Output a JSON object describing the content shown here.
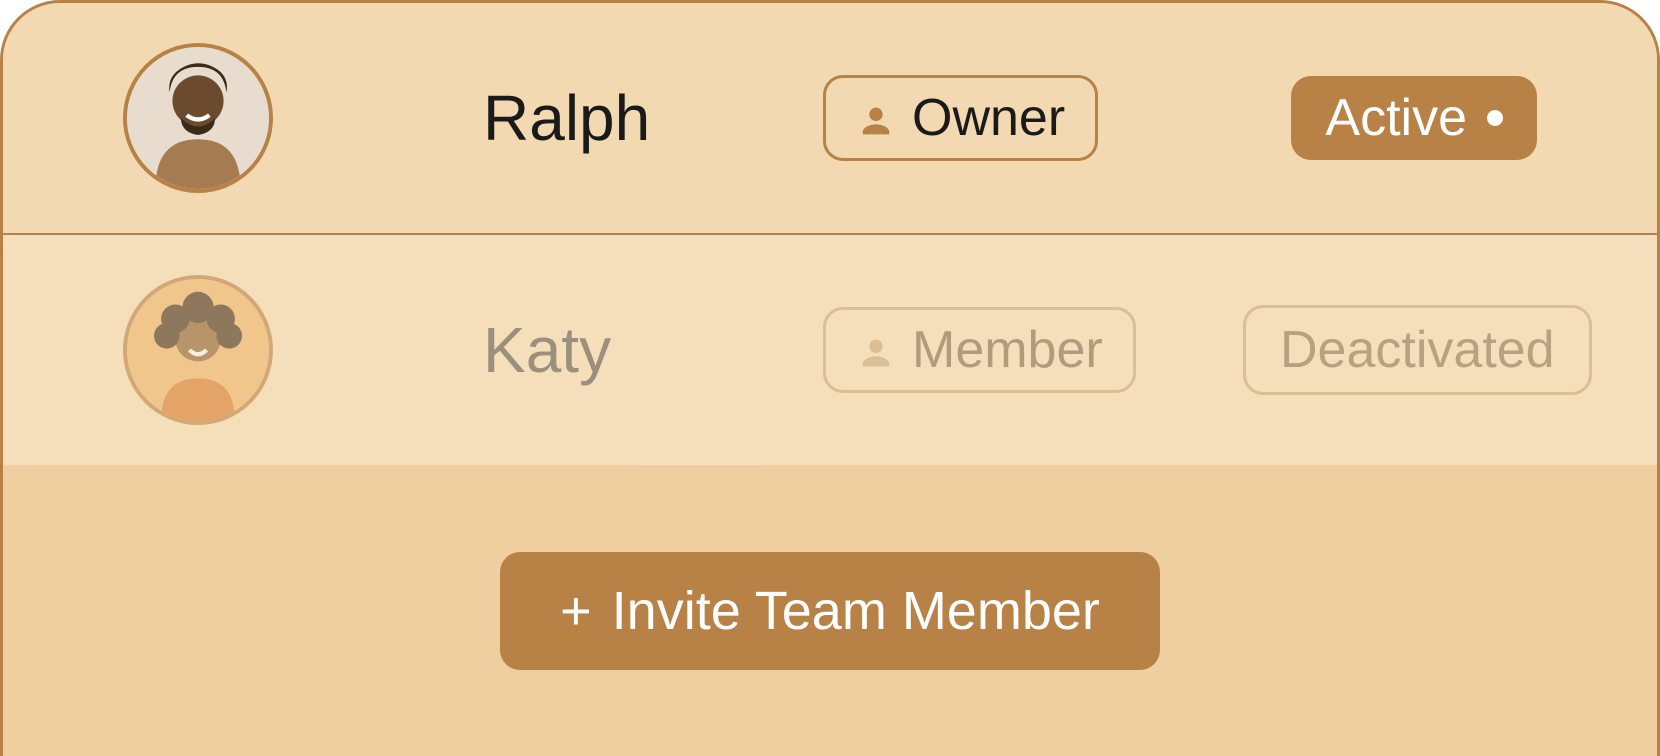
{
  "members": [
    {
      "name": "Ralph",
      "role": "Owner",
      "status": "Active",
      "active": true
    },
    {
      "name": "Katy",
      "role": "Member",
      "status": "Deactivated",
      "active": false
    }
  ],
  "invite_label": "Invite Team Member",
  "colors": {
    "accent": "#b88246",
    "bg_light": "#f3d9b2",
    "bg_lighter": "#f8e4c4",
    "bg_footer": "#efcf9f"
  }
}
